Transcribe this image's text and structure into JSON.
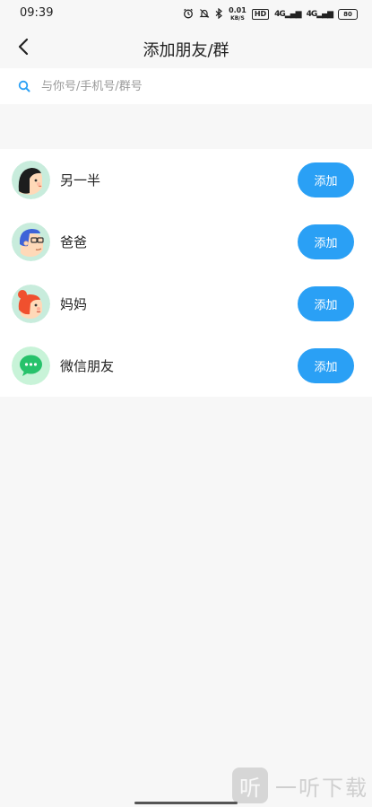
{
  "status_bar": {
    "time": "09:39",
    "network_speed_value": "0.01",
    "network_speed_unit": "KB/S",
    "hd_label": "HD",
    "signal_1": "4G",
    "signal_2": "4G",
    "battery": "80"
  },
  "header": {
    "title": "添加朋友/群"
  },
  "search": {
    "placeholder": "与你号/手机号/群号",
    "value": ""
  },
  "contacts": [
    {
      "label": "另一半",
      "button": "添加",
      "avatar": "woman-avatar"
    },
    {
      "label": "爸爸",
      "button": "添加",
      "avatar": "man-glasses-avatar"
    },
    {
      "label": "妈妈",
      "button": "添加",
      "avatar": "red-hair-woman-avatar"
    },
    {
      "label": "微信朋友",
      "button": "添加",
      "avatar": "wechat-icon"
    }
  ],
  "watermark": {
    "logo_char": "听",
    "text": "一听下载"
  },
  "colors": {
    "accent": "#2aa0f5",
    "avatar_bg": "#c8ecdc",
    "wechat_green": "#27c26b"
  }
}
